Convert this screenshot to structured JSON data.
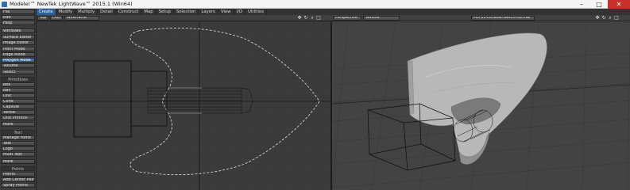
{
  "window": {
    "title": "Modeler™ NewTek LightWave™ 2015.1 (Win64)",
    "minimize_icon": "minimize-icon",
    "maximize_icon": "maximize-icon",
    "close_icon": "close-icon"
  },
  "sidebar": {
    "top_menus": [
      "File",
      "Edit",
      "Help"
    ],
    "windows": "Windows",
    "editors": [
      "Surface Editor",
      "Image Editor"
    ],
    "modes": [
      "Point Mode",
      "Edge Mode",
      "Polygon Mode",
      "Volume"
    ],
    "select": "Select",
    "primitives_header": "Primitives",
    "primitives": [
      "Box",
      "Ball",
      "Disc",
      "Cone",
      "Capsule",
      "Toroid",
      "Unit Primitiv"
    ],
    "more1": "More",
    "text_header": "Text",
    "text_items": [
      "Manage Fonts",
      "Text",
      "Logo",
      "Multi Text"
    ],
    "more2": "More",
    "points_header": "Points",
    "points_items": [
      "Points",
      "Add Center Point",
      "Spray Points"
    ]
  },
  "tabs": {
    "items": [
      "Create",
      "Modify",
      "Multiply",
      "Detail",
      "Construct",
      "Map",
      "Setup",
      "Selection",
      "Layers",
      "View",
      "I/O",
      "Utilities"
    ],
    "active": "Create"
  },
  "left_viewport": {
    "view": "Top",
    "axis": "(XZ)",
    "shading": "Wireframe"
  },
  "right_viewport": {
    "view": "Perspective",
    "shading": "Texture",
    "file": "PDF11-console-switch-normal"
  },
  "colors": {
    "active_tab": "#2f5f97",
    "active_mode": "#3a6aa0",
    "close_button": "#c9302c"
  }
}
